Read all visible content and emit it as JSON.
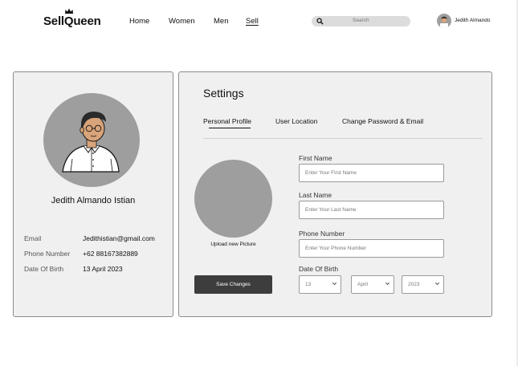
{
  "brand": {
    "name": "SellQueen",
    "crown_icon": "crown-icon"
  },
  "nav": {
    "home": "Home",
    "women": "Women",
    "men": "Men",
    "sell": "Sell"
  },
  "search": {
    "placeholder": "Search",
    "icon": "search-icon"
  },
  "user": {
    "name": "Jedith Almando"
  },
  "profile": {
    "full_name": "Jedith Almando Istian",
    "email_label": "Email",
    "email": "Jedithistian@gmail.com",
    "phone_label": "Phone Number",
    "phone": "+62 88167382889",
    "dob_label": "Date Of Birth",
    "dob": "13 April 2023"
  },
  "settings": {
    "title": "Settings",
    "tabs": [
      {
        "label": "Personal Profile",
        "active": true
      },
      {
        "label": "User Location",
        "active": false
      },
      {
        "label": "Change Password & Email",
        "active": false
      }
    ],
    "upload_label": "Upload new Picture",
    "save_label": "Save Changes",
    "fields": {
      "first_name": {
        "label": "First Name",
        "placeholder": "Enter Your First Name"
      },
      "last_name": {
        "label": "Last Name",
        "placeholder": "Enter Your Last Name"
      },
      "phone": {
        "label": "Phone Number",
        "placeholder": "Enter Your Phone Number"
      },
      "dob": {
        "label": "Date Of Birth",
        "day": "13",
        "month": "April",
        "year": "2023"
      }
    }
  },
  "colors": {
    "card_bg": "#f0f0f0",
    "avatar_bg": "#9e9e9e",
    "button_bg": "#3d3d3d",
    "search_bg": "#dcdcdc"
  }
}
